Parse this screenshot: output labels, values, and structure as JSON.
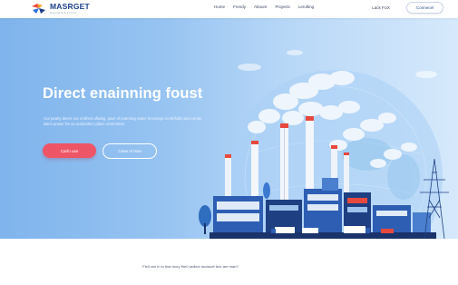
{
  "brand": {
    "name": "MASRGET",
    "tagline": "GENERATION"
  },
  "nav": {
    "items": [
      "Home",
      "Frendy",
      "Aboure",
      "Projects",
      "Lerulting"
    ],
    "login": "Lack FUX",
    "cta": "Connecel"
  },
  "hero": {
    "title": "Direct enainning foust",
    "subtitle": "Cur  pealty deers our erolfect uftaing, paer of inarming rpaec  hevnings on Bnfolks and centin latics power for an ausfustner plave renerclose.",
    "primary_btn": "Carfo use",
    "secondary_btn": "Ceae m how"
  },
  "footer": {
    "text": "Fiell cen in to that mory fhe0 ardlect doclacet tenr are man?"
  },
  "colors": {
    "accent": "#ee5566",
    "brand": "#1d3f8c",
    "sky": "#96c3f1"
  }
}
